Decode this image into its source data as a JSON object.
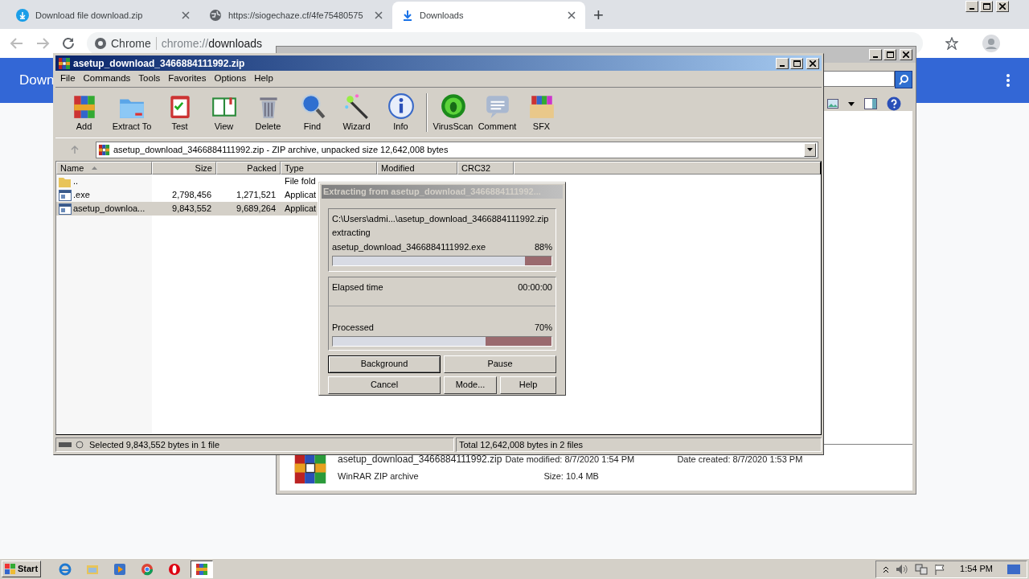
{
  "browser": {
    "tabs": [
      {
        "title": "Download file download.zip",
        "selected": false
      },
      {
        "title": "https://siogechaze.cf/4fe75480575",
        "selected": false
      },
      {
        "title": "Downloads",
        "selected": true
      }
    ],
    "new_tab": "+",
    "omnibox": {
      "origin": "Chrome",
      "url_scheme": "chrome://",
      "url_path": "downloads"
    },
    "page_header": "Down"
  },
  "explorer": {
    "file": {
      "name": "asetup_download_3466884111992.zip",
      "type": "WinRAR ZIP archive",
      "modified_label": "Date modified:",
      "modified": "8/7/2020 1:54 PM",
      "created_label": "Date created:",
      "created": "8/7/2020 1:53 PM",
      "size_label": "Size:",
      "size": "10.4 MB"
    }
  },
  "winrar": {
    "title": "asetup_download_3466884111992.zip",
    "menu": [
      "File",
      "Commands",
      "Tools",
      "Favorites",
      "Options",
      "Help"
    ],
    "toolbar": [
      "Add",
      "Extract To",
      "Test",
      "View",
      "Delete",
      "Find",
      "Wizard",
      "Info",
      "VirusScan",
      "Comment",
      "SFX"
    ],
    "address": "asetup_download_3466884111992.zip - ZIP archive, unpacked size 12,642,008 bytes",
    "columns": [
      {
        "label": "Name",
        "sorted": true
      },
      {
        "label": "Size",
        "sorted": false
      },
      {
        "label": "Packed",
        "sorted": false
      },
      {
        "label": "Type",
        "sorted": false
      },
      {
        "label": "Modified",
        "sorted": false
      },
      {
        "label": "CRC32",
        "sorted": false
      }
    ],
    "rows": [
      {
        "kind": "folder",
        "name": "..",
        "type": "File fold",
        "selected": false
      },
      {
        "kind": "file",
        "name": ".exe",
        "size": "2,798,456",
        "packed": "1,271,521",
        "type": "Applicat",
        "selected": false
      },
      {
        "kind": "file",
        "name": "asetup_downloa...",
        "size": "9,843,552",
        "packed": "9,689,264",
        "type": "Applicat",
        "selected": true
      }
    ],
    "status_left": "Selected 9,843,552 bytes in 1 file",
    "status_right": "Total 12,642,008 bytes in 2 files"
  },
  "dialog": {
    "title": "Extracting from asetup_download_3466884111992...",
    "path": "C:\\Users\\admi...\\asetup_download_3466884111992.zip",
    "action": "extracting",
    "file": "asetup_download_3466884111992.exe",
    "file_percent": "88%",
    "file_progress": {
      "level": 0.88
    },
    "elapsed_label": "Elapsed time",
    "elapsed": "00:00:00",
    "processed_label": "Processed",
    "processed_percent": "70%",
    "processed_progress": {
      "level": 0.7
    },
    "buttons": [
      {
        "label": "Background",
        "default": true
      },
      {
        "label": "Pause",
        "default": false
      },
      {
        "label": "Cancel",
        "default": false
      },
      {
        "label": "Mode...",
        "default": false
      },
      {
        "label": "Help",
        "default": false
      }
    ]
  },
  "taskbar": {
    "start": "Start",
    "apps": [
      {
        "selected": false
      },
      {
        "selected": false
      },
      {
        "selected": false
      },
      {
        "selected": false
      },
      {
        "selected": false
      },
      {
        "selected": true
      }
    ],
    "clock": "1:54 PM"
  }
}
